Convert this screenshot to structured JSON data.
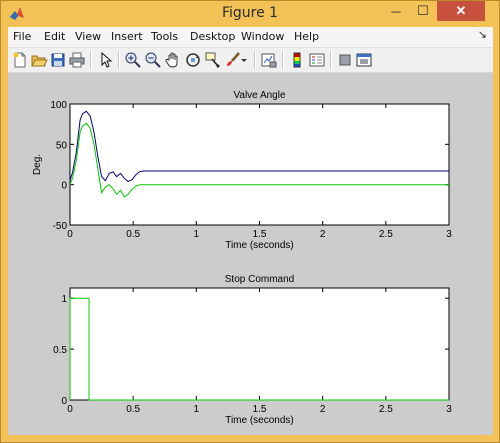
{
  "window": {
    "title": "Figure 1",
    "minimize_glyph": "─",
    "maximize_glyph": "☐",
    "close_glyph": "✕"
  },
  "menubar": {
    "items": [
      "File",
      "Edit",
      "View",
      "Insert",
      "Tools",
      "Desktop",
      "Window",
      "Help"
    ],
    "overflow_glyph": "↘"
  },
  "toolbar": {
    "tools": [
      "new-figure",
      "open-file",
      "save",
      "print",
      "edit-plot-arrow",
      "zoom-in",
      "zoom-out",
      "pan-hand",
      "rotate-3d",
      "data-cursor",
      "brush",
      "brush-dropdown",
      "link-plot",
      "insert-colorbar",
      "insert-legend",
      "hide-plot-tools",
      "show-plot-tools"
    ]
  },
  "colors": {
    "window_frame": "#f3c35a",
    "figure_bg": "#cccccc",
    "axes_bg": "#ffffff",
    "series_blue": "#000080",
    "series_green": "#00cc00"
  },
  "chart_data": [
    {
      "type": "line",
      "title": "Valve Angle",
      "xlabel": "Time (seconds)",
      "ylabel": "Deg.",
      "xlim": [
        0,
        3
      ],
      "ylim": [
        -50,
        100
      ],
      "x_ticks": [
        "0",
        "0.5",
        "1",
        "1.5",
        "2",
        "2.5",
        "3"
      ],
      "y_ticks": [
        "-50",
        "0",
        "50",
        "100"
      ],
      "x_tick_values": [
        0,
        0.5,
        1,
        1.5,
        2,
        2.5,
        3
      ],
      "y_tick_values": [
        -50,
        0,
        50,
        100
      ],
      "grid": false,
      "series": [
        {
          "color": "#000080",
          "x": [
            0,
            0.02,
            0.05,
            0.08,
            0.1,
            0.13,
            0.16,
            0.19,
            0.22,
            0.25,
            0.28,
            0.31,
            0.34,
            0.37,
            0.4,
            0.43,
            0.46,
            0.49,
            0.52,
            0.55,
            0.58,
            0.6,
            0.7,
            1.0,
            2.0,
            3.0
          ],
          "y": [
            5,
            15,
            40,
            80,
            88,
            91,
            85,
            65,
            35,
            10,
            5,
            14,
            16,
            10,
            14,
            8,
            4,
            6,
            12,
            16,
            17,
            17,
            17,
            17,
            17,
            17
          ]
        },
        {
          "color": "#00cc00",
          "x": [
            0,
            0.02,
            0.05,
            0.08,
            0.1,
            0.13,
            0.16,
            0.19,
            0.22,
            0.25,
            0.28,
            0.31,
            0.34,
            0.37,
            0.4,
            0.43,
            0.46,
            0.49,
            0.52,
            0.55,
            0.58,
            0.6,
            0.7,
            1.0,
            2.0,
            3.0
          ],
          "y": [
            0,
            8,
            30,
            65,
            73,
            76,
            70,
            50,
            20,
            -10,
            -3,
            0,
            -5,
            -12,
            -7,
            -15,
            -12,
            -6,
            -2,
            0,
            0,
            0,
            0,
            0,
            0,
            0
          ]
        }
      ]
    },
    {
      "type": "line",
      "title": "Stop Command",
      "xlabel": "Time (seconds)",
      "ylabel": "",
      "xlim": [
        0,
        3
      ],
      "ylim": [
        0,
        1.1
      ],
      "x_ticks": [
        "0",
        "0.5",
        "1",
        "1.5",
        "2",
        "2.5",
        "3"
      ],
      "y_ticks": [
        "0",
        "0.5",
        "1"
      ],
      "x_tick_values": [
        0,
        0.5,
        1,
        1.5,
        2,
        2.5,
        3
      ],
      "y_tick_values": [
        0,
        0.5,
        1
      ],
      "grid": false,
      "series": [
        {
          "color": "#00cc00",
          "x": [
            0,
            0,
            0.15,
            0.15,
            3
          ],
          "y": [
            0,
            1,
            1,
            0,
            0
          ]
        }
      ]
    }
  ]
}
